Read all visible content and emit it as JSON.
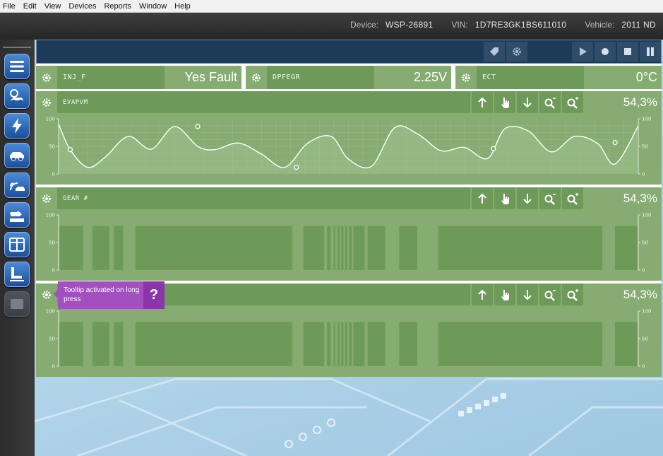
{
  "menu": {
    "items": [
      "File",
      "Edit",
      "View",
      "Devices",
      "Reports",
      "Window",
      "Help"
    ]
  },
  "device_info": {
    "device_label": "Device:",
    "device_value": "WSP-26891",
    "vin_label": "VIN:",
    "vin_value": "1D7RE3GK1BS611010",
    "vehicle_label": "Vehicle:",
    "vehicle_value": "2011 ND"
  },
  "dock": {
    "icons": [
      "menu-icon",
      "car-diagnostic-icon",
      "lightning-icon",
      "car-icon",
      "car-signal-icon",
      "odometer-icon",
      "panels-icon",
      "seat-icon",
      "disabled-module-icon"
    ]
  },
  "toolbar": {
    "icons": [
      "tag-icon",
      "gear-icon",
      "play-icon",
      "record-icon",
      "stop-icon",
      "pause-icon"
    ]
  },
  "gauges": [
    {
      "label": "INJ_F",
      "value": "Yes Fault"
    },
    {
      "label": "DPFEGR",
      "value": "2.25V"
    },
    {
      "label": "ECT",
      "value": "0°C"
    }
  ],
  "charts": [
    {
      "label": "EVAPVM",
      "percent": "54,3%"
    },
    {
      "label": "GEAR #",
      "percent": "54,3%"
    },
    {
      "label": "",
      "percent": "54,3%"
    }
  ],
  "chart_controls": [
    "arrow-up-icon",
    "hand-pointer-icon",
    "arrow-down-icon",
    "zoom-out-icon",
    "zoom-in-icon"
  ],
  "chart_data": [
    {
      "type": "line",
      "title": "EVAPVM",
      "ylim": [
        0,
        100
      ],
      "y_ticks": [
        0,
        50,
        100
      ],
      "grid": true,
      "x": [
        0,
        2,
        5,
        8,
        12,
        16,
        20,
        24,
        27,
        31,
        35,
        39,
        43,
        47,
        50,
        54,
        58,
        62,
        66,
        70,
        74,
        77,
        81,
        85,
        89,
        93,
        96,
        100
      ],
      "y": [
        90,
        44,
        12,
        30,
        68,
        45,
        86,
        50,
        44,
        56,
        36,
        12,
        56,
        68,
        27,
        14,
        84,
        72,
        42,
        48,
        28,
        82,
        78,
        40,
        68,
        55,
        18,
        87
      ],
      "markers": [
        [
          2,
          44
        ],
        [
          24,
          86
        ],
        [
          41,
          12
        ],
        [
          75,
          46
        ],
        [
          96,
          57
        ]
      ]
    },
    {
      "type": "bar",
      "title": "GEAR #",
      "ylim": [
        0,
        100
      ],
      "y_ticks": [
        0,
        50,
        100
      ],
      "segments": [
        [
          0,
          4.3
        ],
        [
          6.0,
          9.1
        ],
        [
          9.9,
          11.6
        ],
        [
          13.8,
          42.3
        ],
        [
          44.3,
          48.1
        ],
        [
          48.6,
          49.3
        ],
        [
          49.8,
          50.1
        ],
        [
          50.5,
          50.9
        ],
        [
          51.2,
          51.6
        ],
        [
          51.9,
          52.3
        ],
        [
          52.6,
          53.1
        ],
        [
          53.4,
          55.4
        ],
        [
          56.0,
          59.2
        ],
        [
          61.7,
          65.0
        ],
        [
          68.8,
          98.6
        ],
        [
          100.9,
          105.0
        ]
      ],
      "value": 80
    },
    {
      "type": "bar",
      "title": "",
      "ylim": [
        0,
        100
      ],
      "y_ticks": [
        0,
        50,
        100
      ],
      "segments": [
        [
          0,
          4.3
        ],
        [
          6.0,
          9.1
        ],
        [
          9.9,
          11.6
        ],
        [
          13.8,
          42.3
        ],
        [
          44.3,
          48.1
        ],
        [
          48.6,
          49.3
        ],
        [
          49.8,
          50.1
        ],
        [
          50.5,
          50.9
        ],
        [
          51.2,
          51.6
        ],
        [
          51.9,
          52.3
        ],
        [
          52.6,
          53.1
        ],
        [
          53.4,
          55.4
        ],
        [
          56.0,
          59.2
        ],
        [
          61.7,
          65.0
        ],
        [
          68.8,
          98.6
        ],
        [
          100.9,
          105.0
        ]
      ],
      "value": 80
    }
  ],
  "tooltip": {
    "text": "Tooltip activated on long press",
    "icon": "?"
  }
}
